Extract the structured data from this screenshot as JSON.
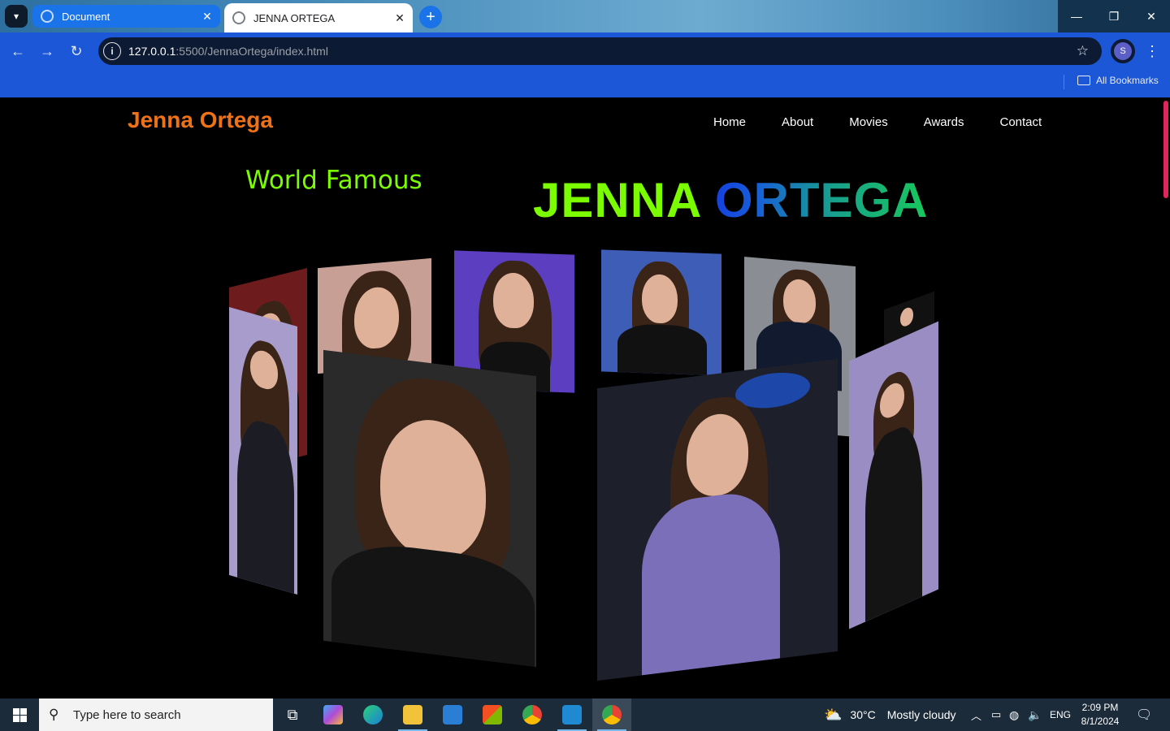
{
  "browser": {
    "tabs": [
      {
        "title": "Document",
        "active": true
      },
      {
        "title": "JENNA ORTEGA",
        "active": false
      }
    ],
    "url_host": "127.0.0.1",
    "url_rest": ":5500/JennaOrtega/index.html",
    "profile_initial": "S",
    "bookmarks_label": "All Bookmarks"
  },
  "site": {
    "logo": "Jenna Ortega",
    "nav": [
      "Home",
      "About",
      "Movies",
      "Awards",
      "Contact"
    ],
    "tagline": "World Famous",
    "hero_first": "JENNA",
    "hero_second": "ORTEGA",
    "colors": {
      "logo": "#f07217",
      "tagline": "#7cfc00",
      "hero_first": "#7cfc00"
    }
  },
  "gallery": {
    "cards": [
      {
        "name": "photo-card-1",
        "bg": "#7a1f22"
      },
      {
        "name": "photo-card-2",
        "bg": "#c8a59c"
      },
      {
        "name": "photo-card-3",
        "bg": "#5a3fbf"
      },
      {
        "name": "photo-card-4",
        "bg": "#3d5cb8"
      },
      {
        "name": "photo-card-5",
        "bg": "#8c8f96"
      },
      {
        "name": "photo-card-6",
        "bg": "#2a2a2a"
      },
      {
        "name": "photo-card-7",
        "bg": "#8e7fb8"
      },
      {
        "name": "photo-card-8",
        "bg": "#2b2b2b"
      },
      {
        "name": "photo-card-9",
        "bg": "#1e1e24"
      },
      {
        "name": "photo-card-10",
        "bg": "#a89cc8"
      }
    ]
  },
  "taskbar": {
    "search_placeholder": "Type here to search",
    "weather_temp": "30°C",
    "weather_text": "Mostly cloudy",
    "language": "ENG",
    "time": "2:09 PM",
    "date": "8/1/2024"
  }
}
